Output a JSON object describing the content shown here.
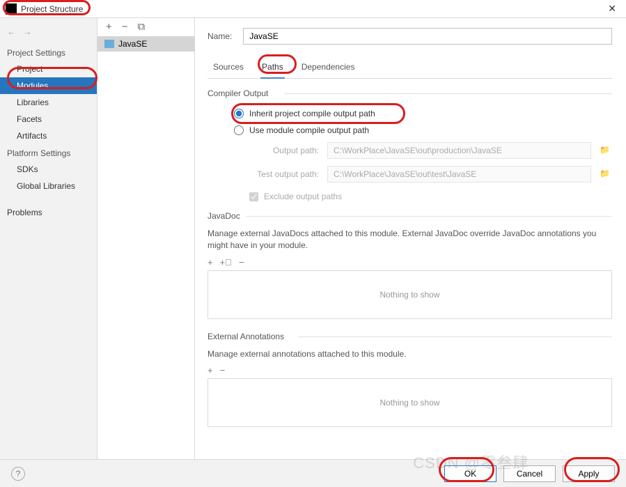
{
  "window": {
    "title": "Project Structure"
  },
  "sidebar": {
    "sections": {
      "project_settings": "Project Settings",
      "platform_settings": "Platform Settings"
    },
    "items": {
      "project": "Project",
      "modules": "Modules",
      "libraries": "Libraries",
      "facets": "Facets",
      "artifacts": "Artifacts",
      "sdks": "SDKs",
      "global_libraries": "Global Libraries",
      "problems": "Problems"
    }
  },
  "module_list": {
    "items": [
      "JavaSE"
    ]
  },
  "content": {
    "name_label": "Name:",
    "name_value": "JavaSE",
    "tabs": {
      "sources": "Sources",
      "paths": "Paths",
      "dependencies": "Dependencies"
    },
    "compiler_output": {
      "title": "Compiler Output",
      "inherit_label": "Inherit project compile output path",
      "use_module_label": "Use module compile output path",
      "output_path_label": "Output path:",
      "output_path_value": "C:\\WorkPlace\\JavaSE\\out\\production\\JavaSE",
      "test_output_label": "Test output path:",
      "test_output_value": "C:\\WorkPlace\\JavaSE\\out\\test\\JavaSE",
      "exclude_label": "Exclude output paths"
    },
    "javadoc": {
      "title": "JavaDoc",
      "desc": "Manage external JavaDocs attached to this module. External JavaDoc override JavaDoc annotations you might have in your module.",
      "empty": "Nothing to show"
    },
    "ext_annotations": {
      "title": "External Annotations",
      "desc": "Manage external annotations attached to this module.",
      "empty": "Nothing to show"
    }
  },
  "footer": {
    "ok": "OK",
    "cancel": "Cancel",
    "apply": "Apply"
  },
  "watermark": "CSDN @零叁肆"
}
